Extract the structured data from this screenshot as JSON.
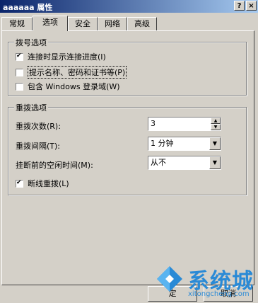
{
  "window": {
    "title": "aaaaaa 属性",
    "help_label": "?",
    "close_label": "×"
  },
  "tabs": [
    {
      "label": "常规"
    },
    {
      "label": "选项"
    },
    {
      "label": "安全"
    },
    {
      "label": "网络"
    },
    {
      "label": "高级"
    }
  ],
  "dial_options": {
    "title": "拨号选项",
    "items": [
      {
        "label": "连接时显示连接进度(I)",
        "checked": true
      },
      {
        "label": "提示名称、密码和证书等(P)",
        "checked": false
      },
      {
        "label": "包含 Windows 登录域(W)",
        "checked": false
      }
    ]
  },
  "redial_options": {
    "title": "重拨选项",
    "redial_attempts_label": "重拨次数(R):",
    "redial_attempts_value": "3",
    "redial_interval_label": "重拨间隔(T):",
    "redial_interval_value": "1 分钟",
    "idle_time_label": "挂断前的空闲时间(M):",
    "idle_time_value": "从不",
    "redial_on_drop_label": "断线重拨(L)",
    "redial_on_drop_checked": true
  },
  "buttons": {
    "ok": "定",
    "cancel": "取消"
  },
  "watermark": {
    "text": "系统城",
    "url": "xitongcheng.com"
  }
}
